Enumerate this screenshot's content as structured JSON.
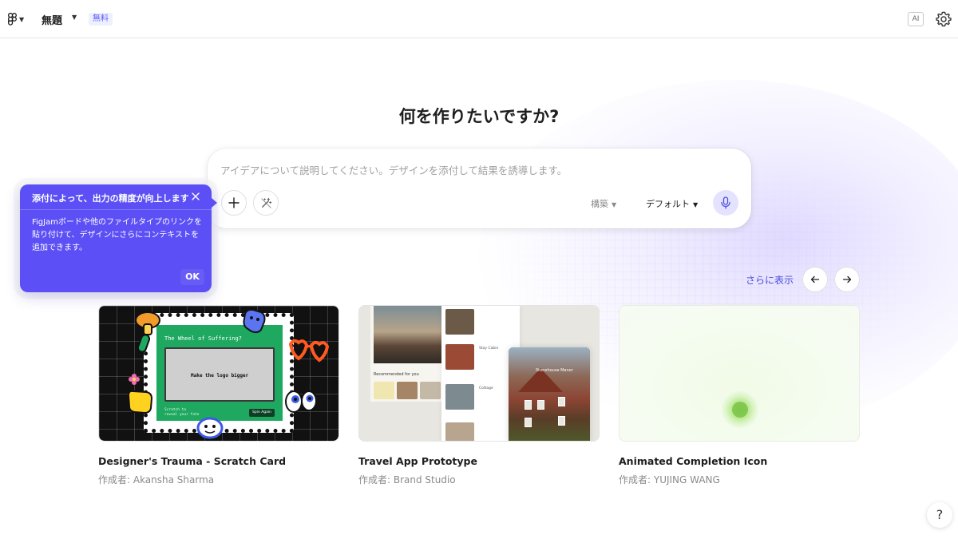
{
  "topbar": {
    "file_title": "無題",
    "plan_badge": "無料",
    "ai_label": "AI"
  },
  "main": {
    "heading": "何を作りたいですか?",
    "prompt": {
      "placeholder": "アイデアについて説明してください。デザインを添付して結果を誘導します。",
      "value": "",
      "mode_select": "構築",
      "model_select": "デフォルト"
    }
  },
  "tooltip": {
    "title": "添付によって、出力の精度が向上します",
    "body": "FigJamボードや他のファイルタイプのリンクを貼り付けて、デザインにさらにコンテキストを追加できます。",
    "ok_label": "OK"
  },
  "carousel": {
    "show_more_label": "さらに表示",
    "cards": [
      {
        "name": "Designer's Trauma - Scratch Card",
        "author": "作成者: Akansha Sharma",
        "thumb_text": {
          "title": "The Wheel of Suffering?",
          "scratch": "Make the logo bigger",
          "small": "Scratch to\nreveal your fate",
          "button": "Spin Again"
        }
      },
      {
        "name": "Travel App Prototype",
        "author": "作成者: Brand Studio",
        "thumb_text": {
          "panel": "Recommended for you",
          "row_1": "Stay Cabin",
          "row_2": "Cottage",
          "phone": "Stonehouse Manor"
        }
      },
      {
        "name": "Animated Completion Icon",
        "author": "作成者: YUJING WANG"
      }
    ]
  },
  "help_label": "?",
  "colors": {
    "accent": "#5b4ff5",
    "link": "#4b4ddb",
    "mic_bg": "#e4e3ff",
    "plan_badge_text": "#5a5cf6"
  },
  "icons": [
    "figma-logo-icon",
    "chevron-down-icon",
    "settings-gear-icon",
    "close-icon",
    "plus-icon",
    "magic-wand-icon",
    "microphone-icon",
    "arrow-left-icon",
    "arrow-right-icon",
    "help-icon"
  ]
}
